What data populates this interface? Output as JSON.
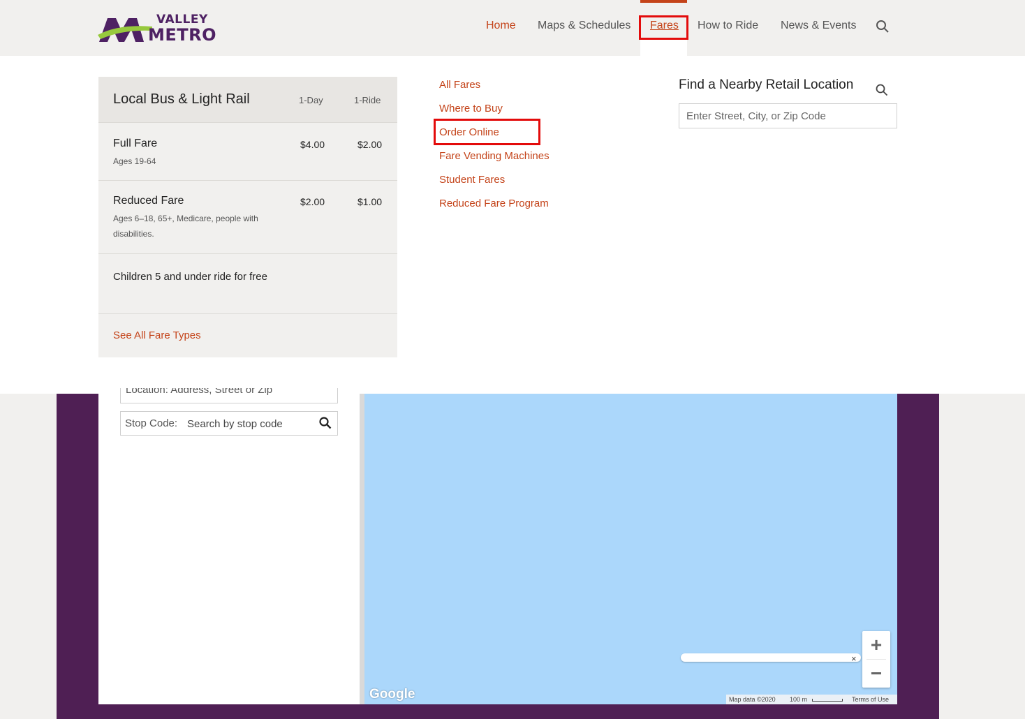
{
  "header": {
    "logo_top": "VALLEY",
    "logo_bottom": "METRO",
    "nav": [
      "Home",
      "Maps & Schedules",
      "Fares",
      "How to Ride",
      "News & Events"
    ],
    "search_icon": "search-icon"
  },
  "fare_table": {
    "title": "Local Bus & Light Rail",
    "columns": [
      "1-Day",
      "1-Ride"
    ],
    "rows": [
      {
        "name": "Full Fare",
        "detail": "Ages 19-64",
        "day": "$4.00",
        "ride": "$2.00"
      },
      {
        "name": "Reduced Fare",
        "detail": "Ages 6–18, 65+, Medicare, people with disabilities.",
        "day": "$2.00",
        "ride": "$1.00"
      }
    ],
    "children_note": "Children 5 and under ride for free",
    "see_all": "See All Fare Types"
  },
  "fare_links": [
    "All Fares",
    "Where to Buy",
    "Order Online",
    "Fare Vending Machines",
    "Student Fares",
    "Reduced Fare Program"
  ],
  "retail": {
    "title": "Find a Nearby Retail Location",
    "placeholder": "Enter Street, City, or Zip Code"
  },
  "trip_planner": {
    "location_peek": "Location:  Address, Street or Zip",
    "stop_label": "Stop Code:",
    "stop_placeholder": "Search by stop code"
  },
  "map": {
    "zoom_in": "+",
    "zoom_out": "−",
    "close": "×",
    "google": "Google",
    "map_data": "Map data ©2020",
    "scale": "100 m",
    "terms": "Terms of Use"
  },
  "colors": {
    "accent": "#c44319",
    "brand_purple": "#4f1f54",
    "highlight": "#e30b0b",
    "map_water": "#abd7fb"
  }
}
